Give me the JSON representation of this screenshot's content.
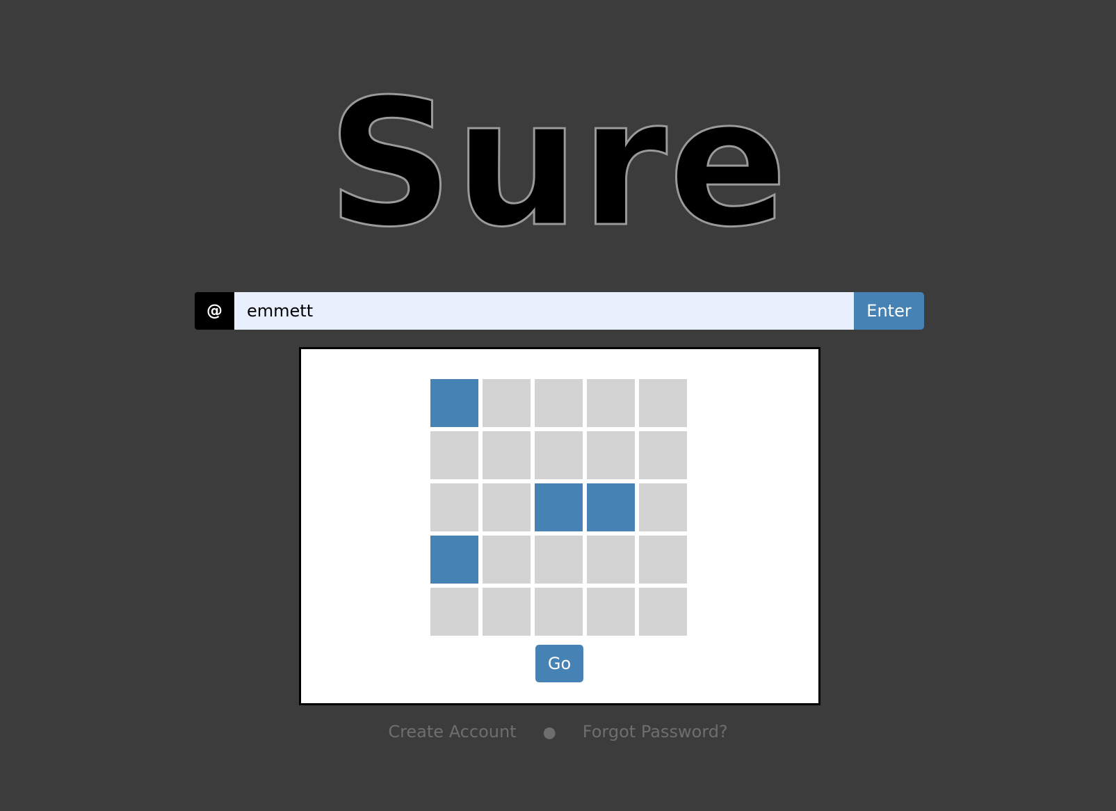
{
  "app": {
    "title": "Sure"
  },
  "login": {
    "prefix": "@",
    "username_value": "emmett",
    "enter_label": "Enter"
  },
  "pattern": {
    "rows": 5,
    "columns": 5,
    "selected": [
      [
        true,
        false,
        false,
        false,
        false
      ],
      [
        false,
        false,
        false,
        false,
        false
      ],
      [
        false,
        false,
        true,
        true,
        false
      ],
      [
        true,
        false,
        false,
        false,
        false
      ],
      [
        false,
        false,
        false,
        false,
        false
      ]
    ],
    "go_label": "Go"
  },
  "footer": {
    "create_account": "Create Account",
    "separator": "●",
    "forgot_password": "Forgot Password?"
  },
  "colors": {
    "background": "#3c3c3c",
    "accent": "#4682b4",
    "cell_off": "#d3d3d3",
    "input_bg": "#e8f0fe"
  }
}
